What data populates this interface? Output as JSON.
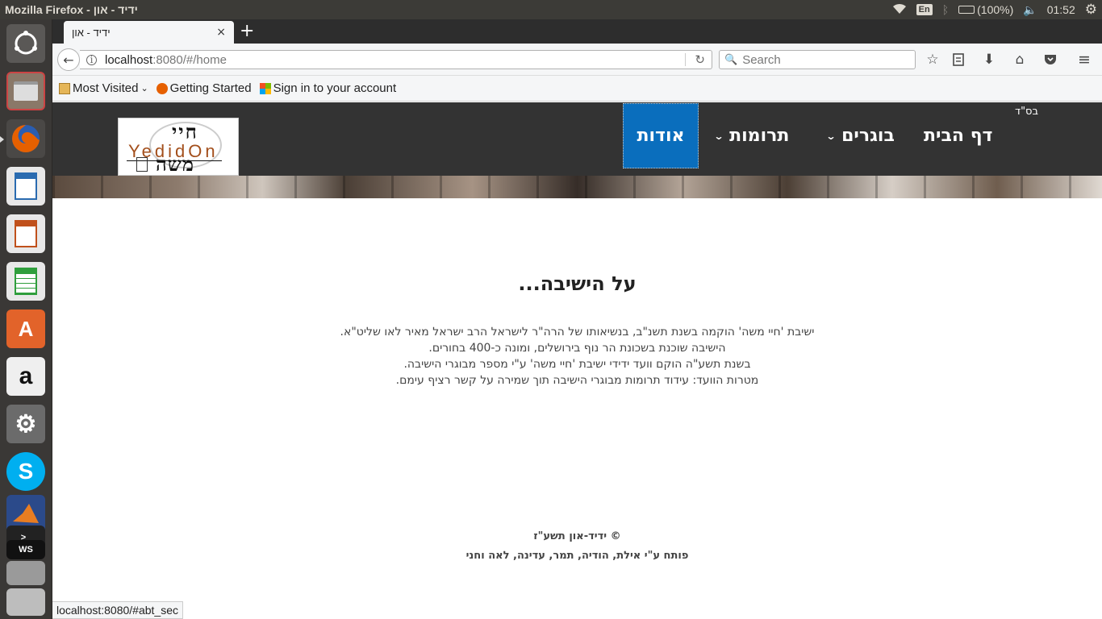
{
  "top_panel": {
    "window_title": "Mozilla Firefox - ידיד - און",
    "keyboard_layout": "En",
    "battery_text": "(100%)",
    "clock": "01:52"
  },
  "launcher": {
    "items": [
      {
        "name": "ubuntu-dash",
        "color": "#6d6b69"
      },
      {
        "name": "files",
        "color": "#7a6a5a"
      },
      {
        "name": "firefox",
        "color": "#e66000"
      },
      {
        "name": "writer",
        "color": "#2a6bb0"
      },
      {
        "name": "impress",
        "color": "#c0501b"
      },
      {
        "name": "calc",
        "color": "#2f9e3c"
      },
      {
        "name": "software-center",
        "color": "#e2632a"
      },
      {
        "name": "amazon",
        "color": "#efefef"
      },
      {
        "name": "system-settings",
        "color": "#6b6b6b"
      },
      {
        "name": "skype",
        "color": "#00aff0"
      },
      {
        "name": "matlab",
        "color": "#2b4a8a"
      },
      {
        "name": "webstorm",
        "color": "#222"
      },
      {
        "name": "scanner",
        "color": "#9a9a9a"
      }
    ]
  },
  "browser": {
    "tab_title": "ידיד - און",
    "tab_close": "×",
    "new_tab": "+",
    "url_host": "localhost",
    "url_path": ":8080/#/home",
    "search_placeholder": "Search",
    "bookmarks": [
      {
        "label": "Most Visited",
        "has_dropdown": true
      },
      {
        "label": "Getting Started"
      },
      {
        "label": "Sign in to your account"
      }
    ],
    "status_url": "localhost:8080/#abt_sec"
  },
  "site": {
    "bsd": "בס\"ד",
    "logo": {
      "top": "חיי",
      "middle": "YedidOn",
      "bottom": "משה"
    },
    "nav": [
      {
        "label": "דף הבית"
      },
      {
        "label": "בוגרים",
        "chevron": "⌄"
      },
      {
        "label": "תרומות",
        "chevron": "⌄"
      },
      {
        "label": "אודות",
        "active": true
      }
    ],
    "about": {
      "title": "על הישיבה...",
      "lines": [
        "ישיבת 'חיי משה' הוקמה בשנת תשנ\"ב, בנשיאותו של הרה\"ר לישראל הרב ישראל מאיר לאו שליט\"א.",
        "הישיבה שוכנת בשכונת הר נוף בירושלים, ומונה כ-400 בחורים.",
        "בשנת תשע\"ה הוקם וועד ידידי ישיבת 'חיי משה' ע\"י מספר מבוגרי הישיבה.",
        "מטרות הוועד: עידוד תרומות מבוגרי הישיבה תוך שמירה על קשר רציף עימם."
      ]
    },
    "footer": {
      "copyright": "© ידיד-און תשע\"ז",
      "credits": "פותח ע\"י אילת, הודיה, תמר, עדינה, לאה וחני"
    },
    "colors": {
      "header_bg": "#333333",
      "active_nav": "#0a6ebd"
    }
  }
}
